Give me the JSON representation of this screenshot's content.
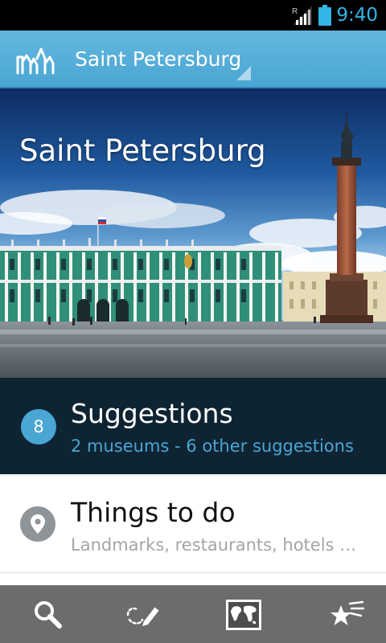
{
  "status_bar": {
    "time": "9:40",
    "network_label": "R",
    "icons": [
      "signal-icon",
      "battery-icon"
    ]
  },
  "action_bar": {
    "logo_icon": "city-skyline-logo-icon",
    "city_selector": "Saint Petersburg"
  },
  "hero": {
    "title": "Saint Petersburg",
    "image": "winter-palace-alexander-column-photo"
  },
  "suggestions": {
    "count": "8",
    "title": "Suggestions",
    "subtitle": "2 museums - 6 other suggestions"
  },
  "things_to_do": {
    "icon": "map-pin-icon",
    "title": "Things to do",
    "subtitle": "Landmarks, restaurants, hotels …"
  },
  "bottom_bar": {
    "items": [
      {
        "icon": "search-icon"
      },
      {
        "icon": "edit-route-icon"
      },
      {
        "icon": "world-map-icon"
      },
      {
        "icon": "favorites-stars-icon"
      }
    ]
  },
  "colors": {
    "accent": "#4aa6d3",
    "action_bar": "#5bb1dc",
    "suggestions_bg": "#0f2433",
    "bottom_bar": "#6c6c6c",
    "status_time": "#33b5e5"
  }
}
